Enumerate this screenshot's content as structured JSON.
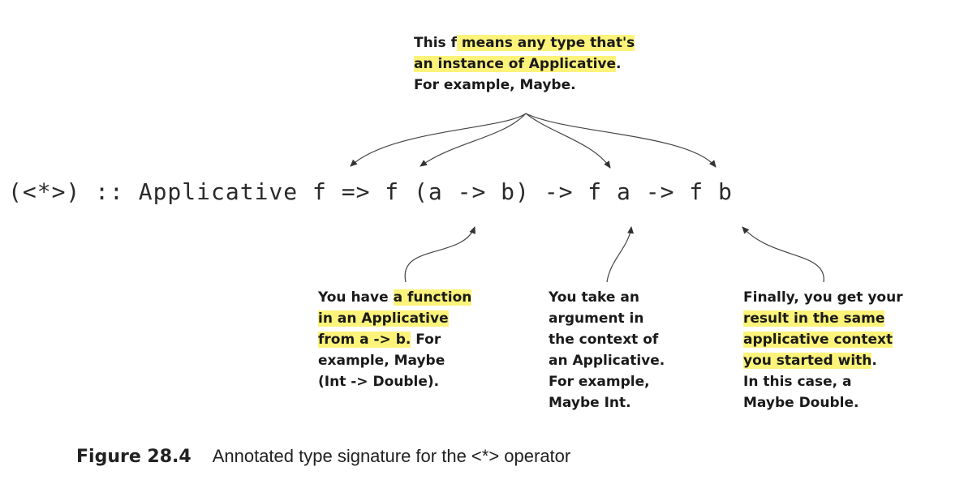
{
  "top_note": {
    "line1_plain": "This f",
    "line1_hl": " means any type that's",
    "line2_hl": "an instance of Applicative",
    "line2_plain": ".",
    "line3": "For example, Maybe."
  },
  "signature": "(<*>) :: Applicative f => f (a -> b) -> f a -> f b",
  "note_function": {
    "l1_plain": "You have ",
    "l1_hl": "a function",
    "l2_hl": "in an Applicative",
    "l3_hl": "from a -> b.",
    "l3_plain": " For",
    "l4": "example, Maybe",
    "l5": "(Int -> Double)."
  },
  "note_argument": {
    "l1": "You take an",
    "l2": "argument in",
    "l3": "the context of",
    "l4": "an Applicative.",
    "l5": "For example,",
    "l6": "Maybe Int."
  },
  "note_result": {
    "l1": "Finally, you get your",
    "l2_hl": "result in the same",
    "l3_hl": "applicative context",
    "l4_hl": "you started with",
    "l4_plain": ".",
    "l5": "In this case, a",
    "l6": "Maybe Double."
  },
  "caption": {
    "figure": "Figure 28.4",
    "text": "Annotated type signature for the <*> operator"
  }
}
